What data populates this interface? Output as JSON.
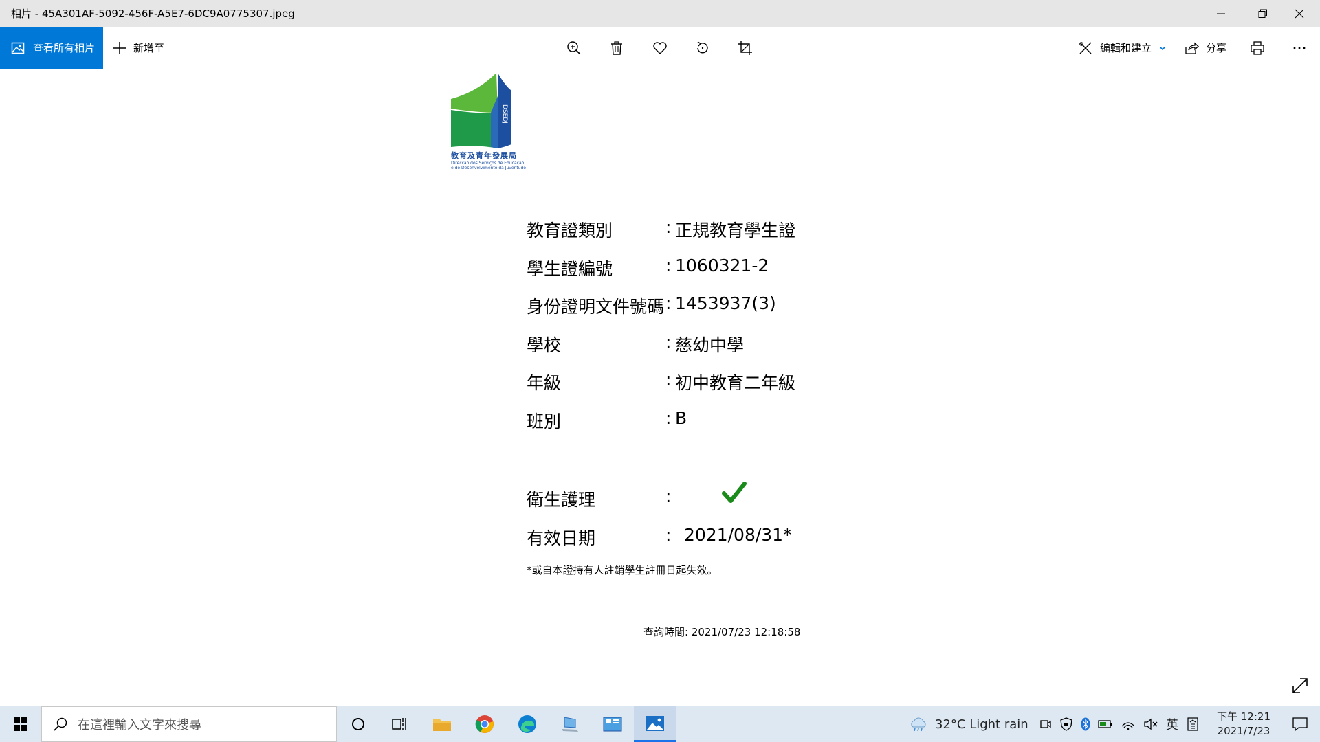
{
  "window": {
    "title": "相片 - 45A301AF-5092-456F-A5E7-6DC9A0775307.jpeg"
  },
  "toolbar": {
    "view_all_label": "查看所有相片",
    "add_to_label": "新增至",
    "edit_create_label": "編輯和建立",
    "share_label": "分享"
  },
  "document": {
    "logo_text": "教育及青年發展局",
    "logo_sub1": "Direcção dos Serviços de Educação",
    "logo_sub2": "e de Desenvolvimento da Juventude",
    "logo_letters": "DSEDJ",
    "fields": [
      {
        "label": "教育證類別",
        "colon": ":",
        "value": "正規教育學生證"
      },
      {
        "label": "學生證編號",
        "colon": ":",
        "value": "1060321-2"
      },
      {
        "label": "身份證明文件號碼",
        "colon": ":",
        "value": "1453937(3)"
      },
      {
        "label": "學校",
        "colon": ":",
        "value": "慈幼中學"
      },
      {
        "label": "年級",
        "colon": ":",
        "value": "初中教育二年級"
      },
      {
        "label": "班別",
        "colon": ":",
        "value": "B"
      }
    ],
    "hygiene": {
      "label": "衛生護理",
      "colon": ":"
    },
    "validity": {
      "label": "有效日期",
      "colon": ":",
      "value": "2021/08/31*"
    },
    "footnote": "*或自本證持有人註銷學生註冊日起失效。",
    "query_time": "查詢時間: 2021/07/23 12:18:58"
  },
  "taskbar": {
    "search_placeholder": "在這裡輸入文字來搜尋",
    "weather": "32°C  Light rain",
    "ime": "英",
    "time": "下午 12:21",
    "date": "2021/7/23"
  },
  "colors": {
    "accent": "#0078d7",
    "check_green": "#1a8a1a",
    "logo_blue": "#1c4fa0",
    "logo_green": "#3cae3c"
  }
}
